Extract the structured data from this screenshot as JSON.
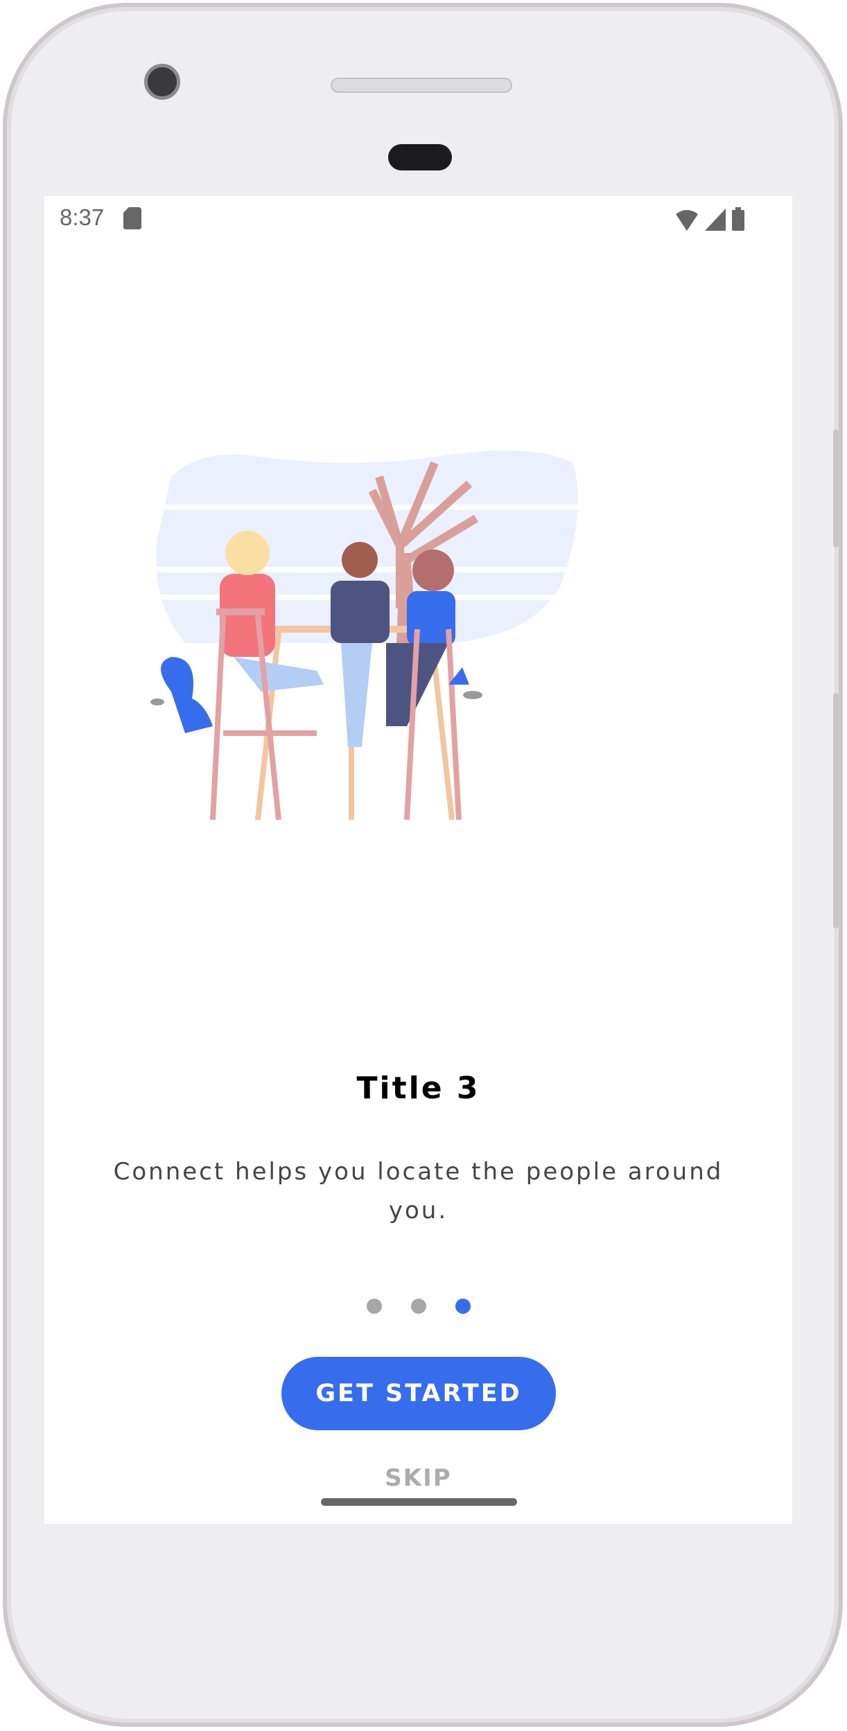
{
  "status_bar": {
    "time": "8:37",
    "icons": [
      "sd-card-icon",
      "wifi-icon",
      "signal-icon",
      "battery-icon"
    ]
  },
  "onboarding": {
    "title": "Title 3",
    "description": "Connect helps you locate the people around you.",
    "page_indicator": {
      "total": 3,
      "current": 3
    },
    "get_started_label": "GET STARTED",
    "skip_label": "SKIP"
  },
  "colors": {
    "accent": "#366ded",
    "dot_inactive": "#a7a7a7",
    "skip": "#acacac"
  }
}
